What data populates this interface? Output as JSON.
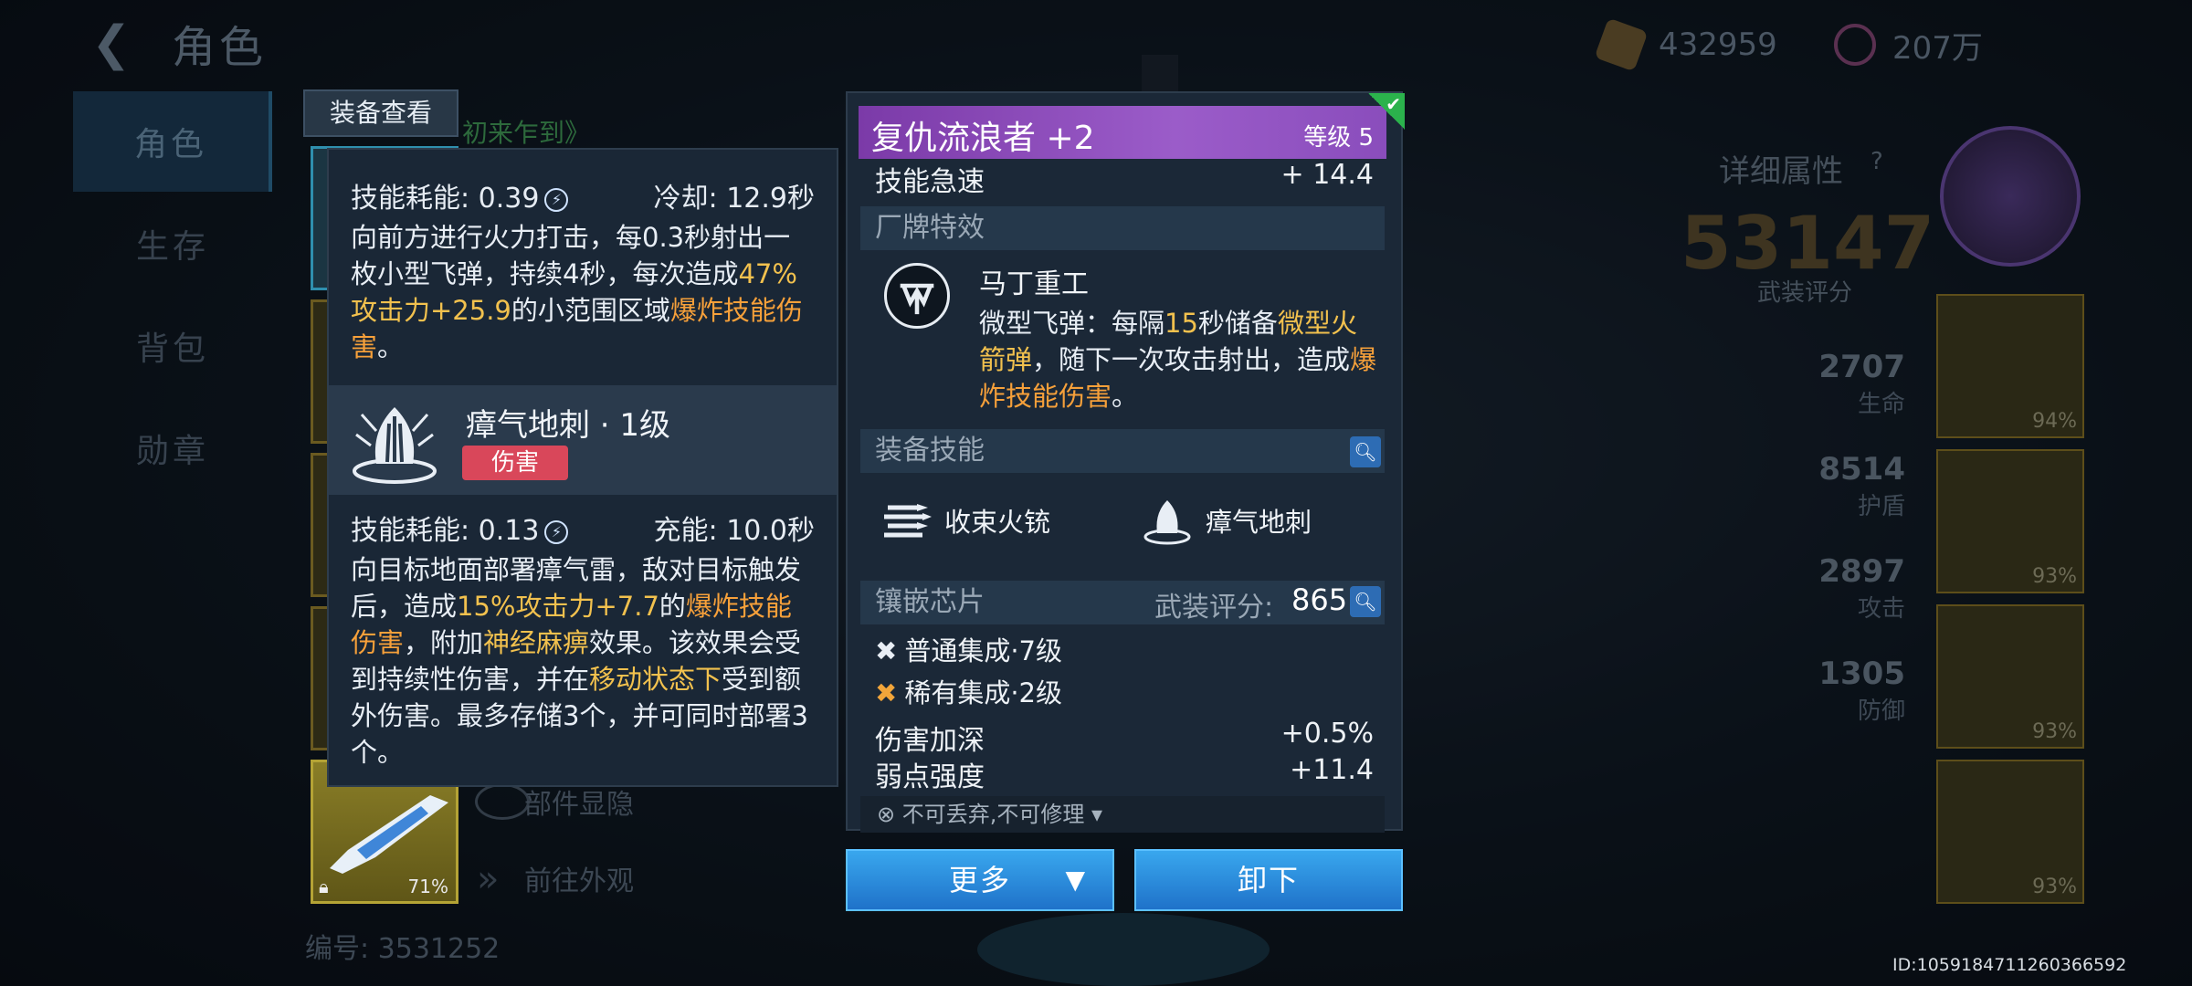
{
  "header": {
    "back_icon": "arrow-left-icon",
    "title": "角色"
  },
  "currency": {
    "gold": "432959",
    "crystal": "207万"
  },
  "left_tabs": [
    "角色",
    "生存",
    "背包",
    "勋章"
  ],
  "background": {
    "link_text": "初来乍到》",
    "toggle_parts": "部件显隐",
    "goto_look": "前往外观",
    "serial": "编号: 3531252",
    "weapon_slot_pct": "71%"
  },
  "equip_view_label": "装备查看",
  "skills_panel": {
    "skill1": {
      "cost_label": "技能耗能: 0.39",
      "cooldown_label": "冷却: 12.9秒",
      "desc_a": "向前方进行火力打击，每0.3秒射出一枚小型飞弹，持续4秒，每次造成",
      "desc_b": "47%攻击力+25.9",
      "desc_c": "的小范围区域",
      "desc_d": "爆炸技能伤害",
      "desc_e": "。"
    },
    "skill2": {
      "name": "瘴气地刺 · 1级",
      "tag": "伤害",
      "cost_label": "技能耗能: 0.13",
      "charge_label": "充能: 10.0秒",
      "desc_a": "向目标地面部署瘴气雷，敌对目标触发后，造成",
      "desc_b": "15%攻击力+7.7",
      "desc_c": "的",
      "desc_d": "爆炸技能伤害",
      "desc_e": "，附加",
      "desc_f": "神经麻痹",
      "desc_g": "效果。该效果会受到持续性伤害，并在",
      "desc_h": "移动状态下",
      "desc_i": "受到额外伤害。最多存储3个，并可同时部署3个。"
    }
  },
  "detail": {
    "name": "复仇流浪者 +2",
    "level": "等级 5",
    "skill_haste_label": "技能急速",
    "skill_haste_value": "+ 14.4",
    "brand_section": "厂牌特效",
    "brand_name": "马丁重工",
    "brand_text_a": "微型飞弹：每隔",
    "brand_text_b": "15",
    "brand_text_c": "秒储备",
    "brand_text_d": "微型火箭弹",
    "brand_text_e": "，随下一次攻击射出，造成",
    "brand_text_f": "爆炸技能伤害",
    "brand_text_g": "。",
    "equip_skill_section": "装备技能",
    "equip_skills": [
      "收束火铳",
      "瘴气地刺"
    ],
    "chip_section": "镶嵌芯片",
    "armor_score_label": "武装评分:",
    "armor_score_value": "865",
    "chips": [
      "普通集成·7级",
      "稀有集成·2级"
    ],
    "stat1_label": "伤害加深",
    "stat1_value": "+0.5%",
    "stat2_label": "弱点强度",
    "stat2_value": "+11.4",
    "footer_note": "不可丢弃,不可修理"
  },
  "buttons": {
    "more": "更多",
    "unequip": "卸下"
  },
  "right_panel": {
    "title": "详细属性",
    "score": "53147",
    "score_label": "武装评分",
    "stats": [
      {
        "value": "2707",
        "label": "生命"
      },
      {
        "value": "8514",
        "label": "护盾"
      },
      {
        "value": "2897",
        "label": "攻击"
      },
      {
        "value": "1305",
        "label": "防御"
      }
    ],
    "gear_pcts": [
      "94%",
      "93%",
      "93%",
      "93%"
    ]
  },
  "id_text": "ID:1059184711260366592",
  "colors": {
    "highlight_yellow": "#f2c14e",
    "highlight_orange": "#f6a03a",
    "title_purple": "#8a4dbc",
    "tag_red": "#d9475a",
    "button_blue": "#2a8ae0"
  }
}
